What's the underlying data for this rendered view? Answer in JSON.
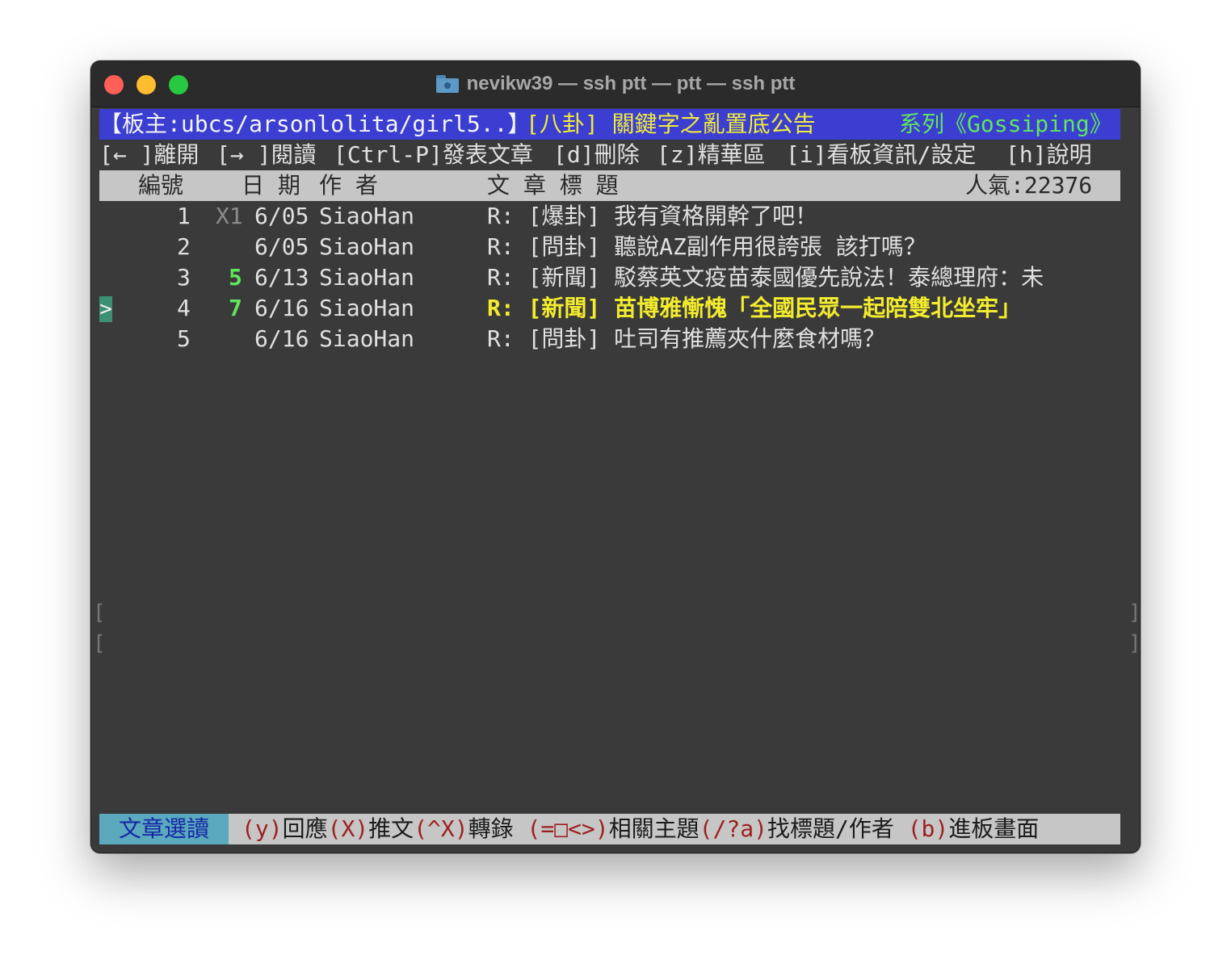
{
  "window": {
    "title": "nevikw39 — ssh ptt — ptt — ssh ptt"
  },
  "header": {
    "moderators": "【板主:ubcs/arsonlolita/girl5..】",
    "announcement": "[八卦] 關鍵字之亂置底公告",
    "series": "系列《Gossiping》"
  },
  "menu": {
    "leave": "[← ]離開",
    "read": "[→ ]閱讀",
    "post": "[Ctrl-P]發表文章",
    "delete": "[d]刪除",
    "digest": "[z]精華區",
    "board_info": "[i]看板資訊/設定",
    "help": "[h]說明"
  },
  "columns": {
    "number": "編號",
    "date": "日 期",
    "author": "作  者",
    "title": "文  章  標  題",
    "popularity": "人氣:22376"
  },
  "cursor": ">",
  "posts": [
    {
      "num": "1",
      "push": "X1",
      "date": "6/05",
      "author": "SiaoHan",
      "title": "R: [爆卦] 我有資格開幹了吧！"
    },
    {
      "num": "2",
      "push": "",
      "date": "6/05",
      "author": "SiaoHan",
      "title": "R: [問卦] 聽說AZ副作用很誇張  該打嗎？"
    },
    {
      "num": "3",
      "push": "5",
      "date": "6/13",
      "author": "SiaoHan",
      "title": "R: [新聞] 駁蔡英文疫苗泰國優先說法！泰總理府：未"
    },
    {
      "num": "4",
      "push": "7",
      "date": "6/16",
      "author": "SiaoHan",
      "title": "R: [新聞] 苗博雅慚愧「全國民眾一起陪雙北坐牢」"
    },
    {
      "num": "5",
      "push": "",
      "date": "6/16",
      "author": "SiaoHan",
      "title": "R: [問卦] 吐司有推薦夾什麼食材嗎？"
    }
  ],
  "status_bar": {
    "mode": "文章選讀",
    "items": [
      {
        "key": "(y)",
        "label": "回應"
      },
      {
        "key": "(X)",
        "label": "推文"
      },
      {
        "key": "(^X)",
        "label": "轉錄"
      },
      {
        "key": "(=□<>)",
        "label": "相關主題"
      },
      {
        "key": "(/?a)",
        "label": "找標題/作者"
      },
      {
        "key": "(b)",
        "label": "進板畫面"
      }
    ]
  },
  "colors": {
    "header_bg": "#3b3ed0",
    "status_key": "#9e1f1f",
    "selected": "#f3ec2e",
    "push_count": "#5fe65c"
  }
}
